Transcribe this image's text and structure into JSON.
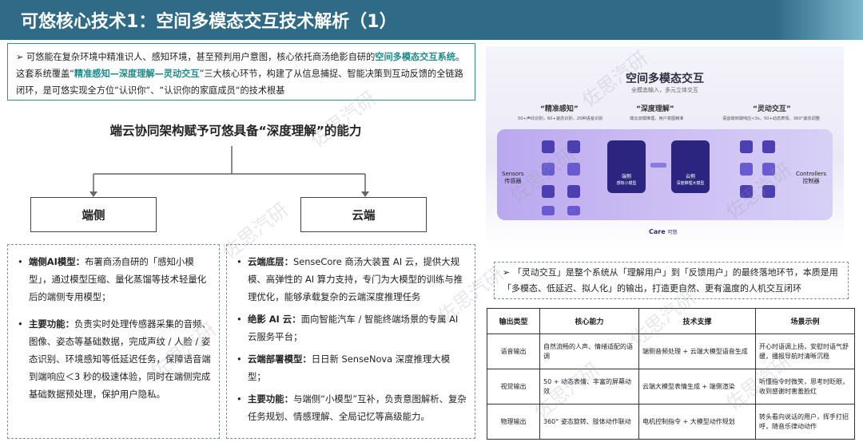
{
  "header": {
    "title": "可悠核心技术1：空间多模态交互技术解析（1）"
  },
  "intro": {
    "bullet": "➢",
    "part1": "可悠能在复杂环境中精准识人、感知环境，甚至预判用户意图，核心依托商汤绝影自研的",
    "highlight1": "空间多模态交互系统",
    "part2": "。这套系统覆盖“",
    "highlight2": "精准感知—深度理解—灵动交互",
    "part3": "”三大核心环节，构建了从信息捕捉、智能决策到互动反馈的全链路闭环，是可悠实现全方位“认识你“、“认识你的家庭成员“的技术根基"
  },
  "architecture": {
    "heading": "端云协同架构赋予可悠具备“深度理解”的能力",
    "left_node": "端侧",
    "right_node": "云端"
  },
  "edge_panel": {
    "items": [
      {
        "label": "端侧AI模型：",
        "text": "布署商汤自研的「感知小模型」，通过模型压缩、量化蒸馏等技术轻量化后的端侧专用模型；"
      },
      {
        "label": "主要功能：",
        "text": "负责实时处理传感器采集的音频、图像、姿态等基础数据，完成声纹 / 人脸 / 姿态识别、环境感知等低延迟任务，保障语音端到端响应＜3 秒的极速体验，同时在端侧完成基础数据预处理，保护用户隐私。"
      }
    ]
  },
  "cloud_panel": {
    "items": [
      {
        "label": "云端底层：",
        "text": "SenseCore 商汤大装置 AI 云，提供大规模、高弹性的 AI 算力支持，专门为大模型的训练与推理优化，能够承载复杂的云端深度推理任务"
      },
      {
        "label": "绝影 AI 云：",
        "text": "面向智能汽车 / 智能终端场景的专属 AI 云服务平台；"
      },
      {
        "label": "云端部署模型：",
        "text": "日日新 SenseNova 深度推理大模型；"
      },
      {
        "label": "主要功能：",
        "text": "与端侧“小模型”互补，负责意图解析、复杂任务规划、情感理解、全局记忆等高级能力。"
      }
    ]
  },
  "diagram": {
    "title": "空间多模态交互",
    "subtitle": "全模态输入，多元立体交互",
    "col1_title": "“精准感知”",
    "col1_sub": "50+声纹识别，60+姿态识别，20种语音识别",
    "col2_title": "“深度理解”",
    "col2_sub": "端云双模推理，用户意图精准",
    "col3_title": "“灵动交互”",
    "col3_sub": "语音端到端响应<3s，50+动态表情，360°姿态调整",
    "sensors_cn": "传感器",
    "sensors_en": "Sensors",
    "controllers_en": "Controllers",
    "controllers_cn": "控制器",
    "edge_label": "端侧",
    "edge_sub": "感知小模型",
    "cloud_label": "云侧",
    "cloud_sub": "深度推理大模型",
    "brand": "Care",
    "brand_cn": "可悠"
  },
  "note": {
    "bullet": "➢",
    "text": "「灵动交互」是整个系统从「理解用户」到「反馈用户」的最终落地环节，本质是用「多模态、低延迟、拟人化」的输出，打造更自然、更有温度的人机交互闭环"
  },
  "table": {
    "headers": [
      "输出类型",
      "核心能力",
      "技术支撑",
      "场景示例"
    ],
    "rows": [
      [
        "语音输出",
        "自然流畅的人声、情绪适配的语调",
        "端侧音频处理 + 云端大模型语音生成",
        "开心时语调上扬，安慰时语气舒缓，播报导航时清晰沉稳"
      ],
      [
        "视觉输出",
        "50 + 动态表情、丰富的屏幕动效",
        "云端大模型表情生成 + 端侧渲染",
        "听懂指令时微笑，思考时眨眼，收到感谢时害羞脸红"
      ],
      [
        "物理输出",
        "360° 姿态旋转、肢体动作联动",
        "电机控制指令 + 大模型动作规划",
        "转头看向说话的用户，挥手打招呼，随音乐律动动作"
      ]
    ]
  },
  "watermark": {
    "text": "佐思汽研"
  }
}
